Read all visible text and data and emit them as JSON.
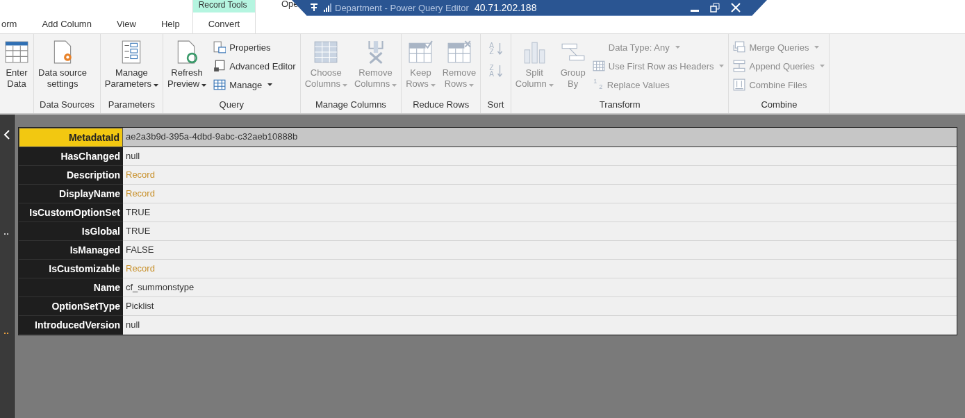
{
  "remote_bar": {
    "title_behind": "Department - Power Query Editor",
    "address": "40.71.202.188"
  },
  "window_title_fragment": "Ope",
  "tabs": [
    {
      "label": "orm",
      "selected": false
    },
    {
      "label": "Add Column",
      "selected": false
    },
    {
      "label": "View",
      "selected": false
    },
    {
      "label": "Help",
      "selected": false
    }
  ],
  "context_group": {
    "title": "Record Tools",
    "tabs": [
      {
        "label": "Convert",
        "selected": false
      }
    ]
  },
  "ribbon_groups": [
    {
      "items": [
        {
          "kind": "large",
          "label": "Enter\nData",
          "disabled": false,
          "dropdown": false
        }
      ]
    },
    {
      "label": "Data Sources",
      "items": [
        {
          "kind": "large",
          "label": "Data source\nsettings",
          "disabled": false,
          "dropdown": false
        }
      ]
    },
    {
      "label": "Parameters",
      "items": [
        {
          "kind": "large",
          "label": "Manage\nParameters",
          "disabled": false,
          "dropdown": true
        }
      ]
    },
    {
      "label": "Query",
      "items": [
        {
          "kind": "large",
          "label": "Refresh\nPreview",
          "disabled": false,
          "dropdown": true
        },
        {
          "kind": "small",
          "label": "Properties",
          "disabled": false,
          "dropdown": false
        },
        {
          "kind": "small",
          "label": "Advanced Editor",
          "disabled": false,
          "dropdown": false
        },
        {
          "kind": "small",
          "label": "Manage",
          "disabled": false,
          "dropdown": true
        }
      ]
    },
    {
      "label": "Manage Columns",
      "items": [
        {
          "kind": "large",
          "label": "Choose\nColumns",
          "disabled": true,
          "dropdown": true
        },
        {
          "kind": "large",
          "label": "Remove\nColumns",
          "disabled": true,
          "dropdown": true
        }
      ]
    },
    {
      "label": "Reduce Rows",
      "items": [
        {
          "kind": "large",
          "label": "Keep\nRows",
          "disabled": true,
          "dropdown": true
        },
        {
          "kind": "large",
          "label": "Remove\nRows",
          "disabled": true,
          "dropdown": true
        }
      ]
    },
    {
      "label": "Sort",
      "items": [
        {
          "kind": "sort",
          "disabled": true,
          "glyphs": [
            [
              "A",
              "Z"
            ],
            [
              "Z",
              "A"
            ]
          ]
        }
      ]
    },
    {
      "label": "Transform",
      "items": [
        {
          "kind": "large",
          "label": "Split\nColumn",
          "disabled": true,
          "dropdown": true
        },
        {
          "kind": "large",
          "label": "Group\nBy",
          "disabled": true,
          "dropdown": false
        },
        {
          "kind": "small",
          "label": "Data Type: Any",
          "disabled": true,
          "dropdown": true
        },
        {
          "kind": "small",
          "label": "Use First Row as Headers",
          "disabled": true,
          "dropdown": true
        },
        {
          "kind": "small",
          "label": "Replace Values",
          "disabled": true,
          "dropdown": false,
          "glyphs": [
            "1",
            "2"
          ]
        }
      ]
    },
    {
      "label": "Combine",
      "items": [
        {
          "kind": "small",
          "label": "Merge Queries",
          "disabled": true,
          "dropdown": true
        },
        {
          "kind": "small",
          "label": "Append Queries",
          "disabled": true,
          "dropdown": true
        },
        {
          "kind": "small",
          "label": "Combine Files",
          "disabled": true,
          "dropdown": false
        }
      ]
    }
  ],
  "record": [
    {
      "key": "MetadataId",
      "value": "ae2a3b9d-395a-4dbd-9abc-c32aeb10888b",
      "kind": "text",
      "selected": true
    },
    {
      "key": "HasChanged",
      "value": "null",
      "kind": "text",
      "selected": false
    },
    {
      "key": "Description",
      "value": "Record",
      "kind": "record",
      "selected": false
    },
    {
      "key": "DisplayName",
      "value": "Record",
      "kind": "record",
      "selected": false
    },
    {
      "key": "IsCustomOptionSet",
      "value": "TRUE",
      "kind": "text",
      "selected": false
    },
    {
      "key": "IsGlobal",
      "value": "TRUE",
      "kind": "text",
      "selected": false
    },
    {
      "key": "IsManaged",
      "value": "FALSE",
      "kind": "text",
      "selected": false
    },
    {
      "key": "IsCustomizable",
      "value": "Record",
      "kind": "record",
      "selected": false
    },
    {
      "key": "Name",
      "value": "cf_summonstype",
      "kind": "text",
      "selected": false
    },
    {
      "key": "OptionSetType",
      "value": "Picklist",
      "kind": "text",
      "selected": false
    },
    {
      "key": "IntroducedVersion",
      "value": "null",
      "kind": "text",
      "selected": false
    }
  ]
}
